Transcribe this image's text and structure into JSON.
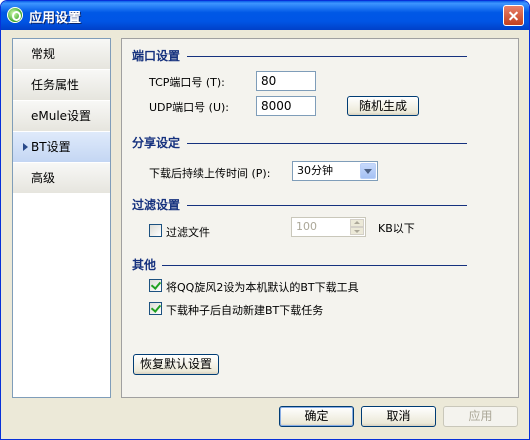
{
  "window": {
    "title": "应用设置"
  },
  "sidebar": {
    "items": [
      {
        "label": "常规"
      },
      {
        "label": "任务属性"
      },
      {
        "label": "eMule设置"
      },
      {
        "label": "BT设置"
      },
      {
        "label": "高级"
      }
    ],
    "selected": "BT设置"
  },
  "ports": {
    "title": "端口设置",
    "tcp_label": "TCP端口号 (T):",
    "tcp_value": "80",
    "udp_label": "UDP端口号 (U):",
    "udp_value": "8000",
    "random_button": "随机生成"
  },
  "share": {
    "title": "分享设定",
    "upload_label": "下载后持续上传时间 (P):",
    "upload_value": "30分钟"
  },
  "filter": {
    "title": "过滤设置",
    "checkbox_label": "过滤文件",
    "checked": false,
    "size_value": "100",
    "unit": "KB以下"
  },
  "other": {
    "title": "其他",
    "opt1_label": "将QQ旋风2设为本机默认的BT下载工具",
    "opt1_checked": true,
    "opt2_label": "下载种子后自动新建BT下载任务",
    "opt2_checked": true
  },
  "restore_button": "恢复默认设置",
  "footer": {
    "ok": "确定",
    "cancel": "取消",
    "apply": "应用"
  }
}
